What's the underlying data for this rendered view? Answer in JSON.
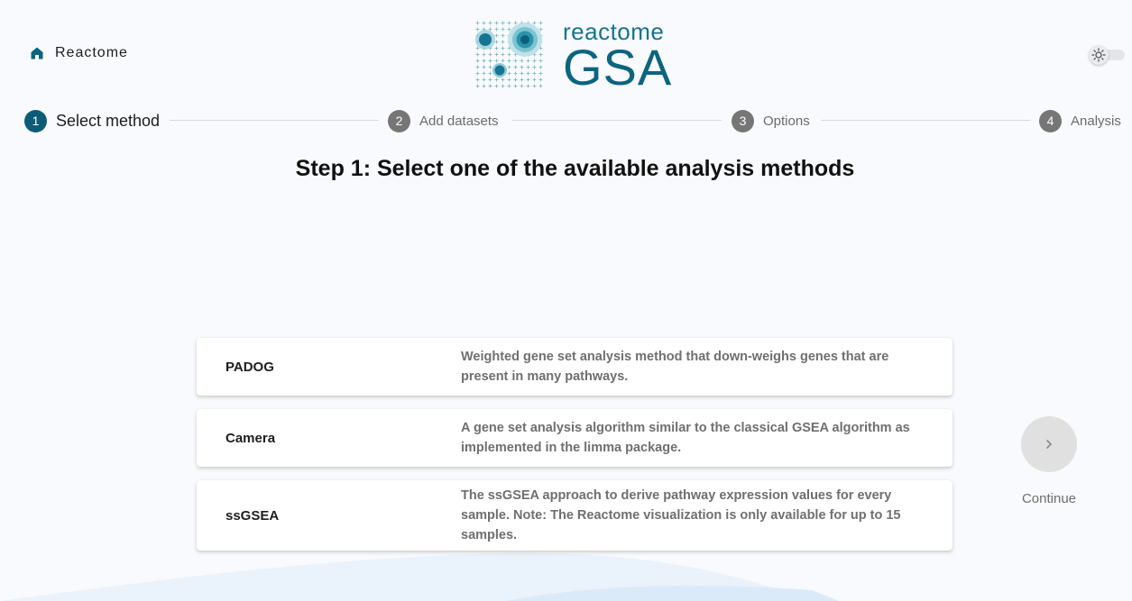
{
  "header": {
    "home_label": "Reactome",
    "logo_small": "reactome",
    "logo_big": "GSA",
    "brand_color": "#0b6480",
    "theme_toggle_icon": "sun-icon"
  },
  "stepper": {
    "steps": [
      {
        "number": "1",
        "label": "Select method",
        "active": true
      },
      {
        "number": "2",
        "label": "Add datasets",
        "active": false
      },
      {
        "number": "3",
        "label": "Options",
        "active": false
      },
      {
        "number": "4",
        "label": "Analysis",
        "active": false
      }
    ],
    "active_color": "#0c5c78",
    "inactive_color": "#767676"
  },
  "main": {
    "title": "Step 1: Select one of the available analysis methods",
    "methods": [
      {
        "name": "PADOG",
        "description": "Weighted gene set analysis method that down-weighs genes that are present in many pathways."
      },
      {
        "name": "Camera",
        "description": "A gene set analysis algorithm similar to the classical GSEA algorithm as implemented in the limma package."
      },
      {
        "name": "ssGSEA",
        "description": "The ssGSEA approach to derive pathway expression values for every sample. Note: The Reactome visualization is only available for up to 15 samples."
      }
    ],
    "continue_label": "Continue",
    "continue_icon": "chevron-right-icon"
  }
}
